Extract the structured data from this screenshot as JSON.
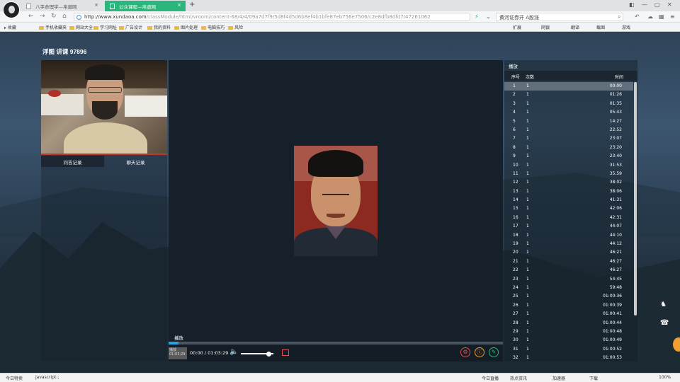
{
  "browser": {
    "tabs": [
      {
        "label": "八字命理学—帛道网"
      },
      {
        "label": "公众课程—帛道网"
      }
    ],
    "new_tab": "+",
    "url_host": "http://www.xundaoa.com",
    "url_rest": "/classModule/html/vroom/content-68/4/4/09a7d7f9/5d8f4d5d6b8ef4b1bfe87eb756e7506/c2e8dfb8dfd7/47261062",
    "search_text": "黄河证券开 A股涨",
    "bookmarks": [
      "收藏",
      "手机收藏夹",
      "网站大全",
      "学习网址",
      "广告设计",
      "我的资料",
      "图片处理",
      "电脑技巧",
      "风险"
    ],
    "bookmarks_right": [
      "扩展",
      "网银",
      "翻译",
      "截图",
      "游戏"
    ],
    "status_left": [
      "今日特卖",
      "javascript:;"
    ],
    "status_right": [
      "今日直播",
      "热点资讯",
      "加速器",
      "下载",
      "100%"
    ]
  },
  "room": {
    "title": "浮图 讲课 97896"
  },
  "left_panel": {
    "tab_active": "问答记录",
    "tab_inactive": "聊天记录"
  },
  "player": {
    "chapter_label": "播放",
    "thumb_label": "播放 01:03:29",
    "time_current": "00:00",
    "time_sep": " / ",
    "time_total": "01:03:29",
    "progress": 0.03,
    "volume": 0.85
  },
  "list": {
    "title": "播放",
    "headers": {
      "index": "序号",
      "count": "次数",
      "time": "时间"
    },
    "selected_index": 0,
    "rows": [
      {
        "n": "1",
        "c": "1",
        "t": "00:00"
      },
      {
        "n": "2",
        "c": "1",
        "t": "01:26"
      },
      {
        "n": "3",
        "c": "1",
        "t": "01:35"
      },
      {
        "n": "4",
        "c": "1",
        "t": "05:43"
      },
      {
        "n": "5",
        "c": "1",
        "t": "14:27"
      },
      {
        "n": "6",
        "c": "1",
        "t": "22:52"
      },
      {
        "n": "7",
        "c": "1",
        "t": "23:07"
      },
      {
        "n": "8",
        "c": "1",
        "t": "23:20"
      },
      {
        "n": "9",
        "c": "1",
        "t": "23:40"
      },
      {
        "n": "10",
        "c": "1",
        "t": "31:53"
      },
      {
        "n": "11",
        "c": "1",
        "t": "35:59"
      },
      {
        "n": "12",
        "c": "1",
        "t": "38:02"
      },
      {
        "n": "13",
        "c": "1",
        "t": "38:06"
      },
      {
        "n": "14",
        "c": "1",
        "t": "41:31"
      },
      {
        "n": "15",
        "c": "1",
        "t": "42:06"
      },
      {
        "n": "16",
        "c": "1",
        "t": "42:31"
      },
      {
        "n": "17",
        "c": "1",
        "t": "44:07"
      },
      {
        "n": "18",
        "c": "1",
        "t": "44:10"
      },
      {
        "n": "19",
        "c": "1",
        "t": "44:12"
      },
      {
        "n": "20",
        "c": "1",
        "t": "46:21"
      },
      {
        "n": "21",
        "c": "1",
        "t": "46:27"
      },
      {
        "n": "22",
        "c": "1",
        "t": "46:27"
      },
      {
        "n": "23",
        "c": "1",
        "t": "54:45"
      },
      {
        "n": "24",
        "c": "1",
        "t": "59:48"
      },
      {
        "n": "25",
        "c": "1",
        "t": "01:00:36"
      },
      {
        "n": "26",
        "c": "1",
        "t": "01:00:39"
      },
      {
        "n": "27",
        "c": "1",
        "t": "01:00:41"
      },
      {
        "n": "28",
        "c": "1",
        "t": "01:00:44"
      },
      {
        "n": "29",
        "c": "1",
        "t": "01:00:48"
      },
      {
        "n": "30",
        "c": "1",
        "t": "01:00:49"
      },
      {
        "n": "31",
        "c": "1",
        "t": "01:00:52"
      },
      {
        "n": "32",
        "c": "1",
        "t": "01:00:53"
      }
    ]
  },
  "icons": {
    "back": "←",
    "forward": "→",
    "reload": "↻",
    "home": "⌂",
    "volume": "🔈",
    "settings": "⚙",
    "info": "ⓘ",
    "edit": "✎",
    "qq": "♞",
    "phone": "☎"
  },
  "colors": {
    "accent_tab": "#2cb67d",
    "progress": "#29a3e0",
    "btn_red": "#e05050",
    "btn_orange": "#f0a030",
    "btn_green": "#2cb67d"
  }
}
